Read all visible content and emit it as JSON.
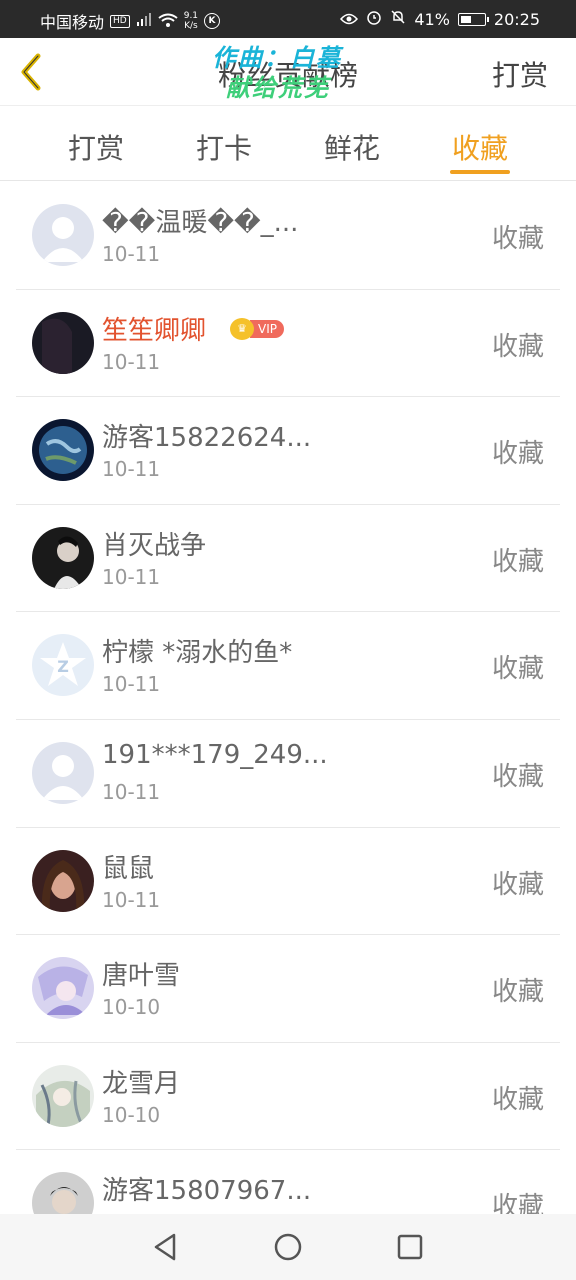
{
  "status_bar": {
    "carrier": "中国移动",
    "hd": "HD",
    "net_speed_value": "9.1",
    "net_speed_unit": "K/s",
    "battery": "41%",
    "time": "20:25"
  },
  "header": {
    "title": "粉丝贡献榜",
    "action_label": "打赏",
    "watermark_line1": "作曲：白墓",
    "watermark_line2": "献给荒芜"
  },
  "tabs": [
    {
      "label": "打赏"
    },
    {
      "label": "打卡"
    },
    {
      "label": "鲜花"
    },
    {
      "label": "收藏"
    }
  ],
  "active_tab": "收藏",
  "accent_color": "#f0a020",
  "list": [
    {
      "name": "��温暖��_...",
      "date": "10-11",
      "action": "收藏",
      "vip": false,
      "avatar": "default-avatar"
    },
    {
      "name": "笙笙卿卿",
      "date": "10-11",
      "action": "收藏",
      "vip": true,
      "vip_label": "VIP",
      "avatar": "photo-avatar"
    },
    {
      "name": "游客15822624...",
      "date": "10-11",
      "action": "收藏",
      "vip": false,
      "avatar": "planet-avatar"
    },
    {
      "name": "肖灭战争",
      "date": "10-11",
      "action": "收藏",
      "vip": false,
      "avatar": "photo-avatar"
    },
    {
      "name": "柠檬 *溺水的鱼*",
      "date": "10-11",
      "action": "收藏",
      "vip": false,
      "avatar": "z-logo-avatar"
    },
    {
      "name": "191***179_249...",
      "date": "10-11",
      "action": "收藏",
      "vip": false,
      "avatar": "default-avatar"
    },
    {
      "name": "鼠鼠",
      "date": "10-11",
      "action": "收藏",
      "vip": false,
      "avatar": "photo-avatar"
    },
    {
      "name": "唐叶雪",
      "date": "10-10",
      "action": "收藏",
      "vip": false,
      "avatar": "anime-avatar"
    },
    {
      "name": "龙雪月",
      "date": "10-10",
      "action": "收藏",
      "vip": false,
      "avatar": "anime-avatar"
    },
    {
      "name": "游客15807967...",
      "date": "",
      "action": "收藏",
      "vip": false,
      "avatar": "photo-avatar"
    }
  ]
}
